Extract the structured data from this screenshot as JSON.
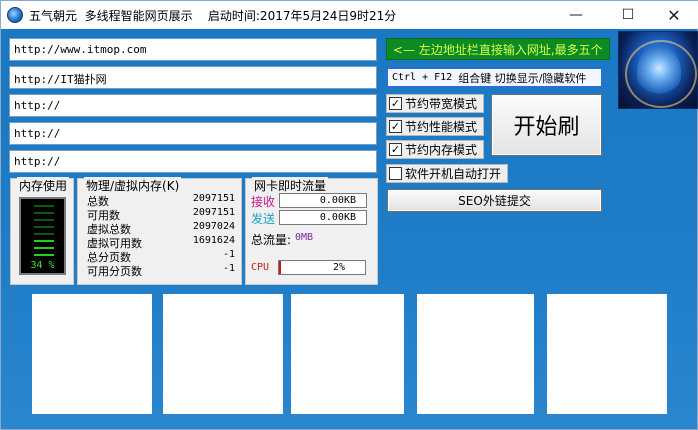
{
  "window": {
    "title": "五气朝元  多线程智能网页展示    启动时间:2017年5月24日9时21分",
    "min_glyph": "—",
    "max_glyph": "☐",
    "close_glyph": "✕"
  },
  "urls": [
    "http://www.itmop.com",
    "http://IT猫扑网",
    "http://",
    "http://",
    "http://"
  ],
  "banner": {
    "text": "<— 左边地址栏直接输入网址,最多五个"
  },
  "hotkey": {
    "keys": "Ctrl + F12",
    "text": "组合键 切换显示/隐藏软件"
  },
  "options": [
    {
      "label": "节约带宽模式",
      "checked": true,
      "mark": "✓"
    },
    {
      "label": "节约性能模式",
      "checked": true,
      "mark": "✓"
    },
    {
      "label": "节约内存模式",
      "checked": true,
      "mark": "✓"
    },
    {
      "label": "软件开机自动打开",
      "checked": false,
      "mark": ""
    }
  ],
  "buttons": {
    "start": "开始刷",
    "seo": "SEO外链提交"
  },
  "memory_usage": {
    "title": "内存使用",
    "percent_text": "34 %",
    "percent": 34
  },
  "physical_memory": {
    "title": "物理/虚拟内存(K)",
    "rows": [
      {
        "label": "总数",
        "value": "2097151"
      },
      {
        "label": "可用数",
        "value": "2097151"
      },
      {
        "label": "虚拟总数",
        "value": "2097024"
      },
      {
        "label": "虚拟可用数",
        "value": "1691624"
      },
      {
        "label": "总分页数",
        "value": "-1"
      },
      {
        "label": "可用分页数",
        "value": "-1"
      }
    ]
  },
  "network": {
    "title": "网卡即时流量",
    "recv_label": "接收",
    "recv_value": "0.00KB",
    "send_label": "发送",
    "send_value": "0.00KB",
    "total_label": "总流量:",
    "total_value": "0MB",
    "cpu_label": "CPU",
    "cpu_text": "2%",
    "cpu_percent": 2
  },
  "colors": {
    "recv": "#c8168c",
    "send": "#1aa0c8",
    "total_value": "#7a2aa0",
    "cpu_label": "#c81c1c"
  }
}
